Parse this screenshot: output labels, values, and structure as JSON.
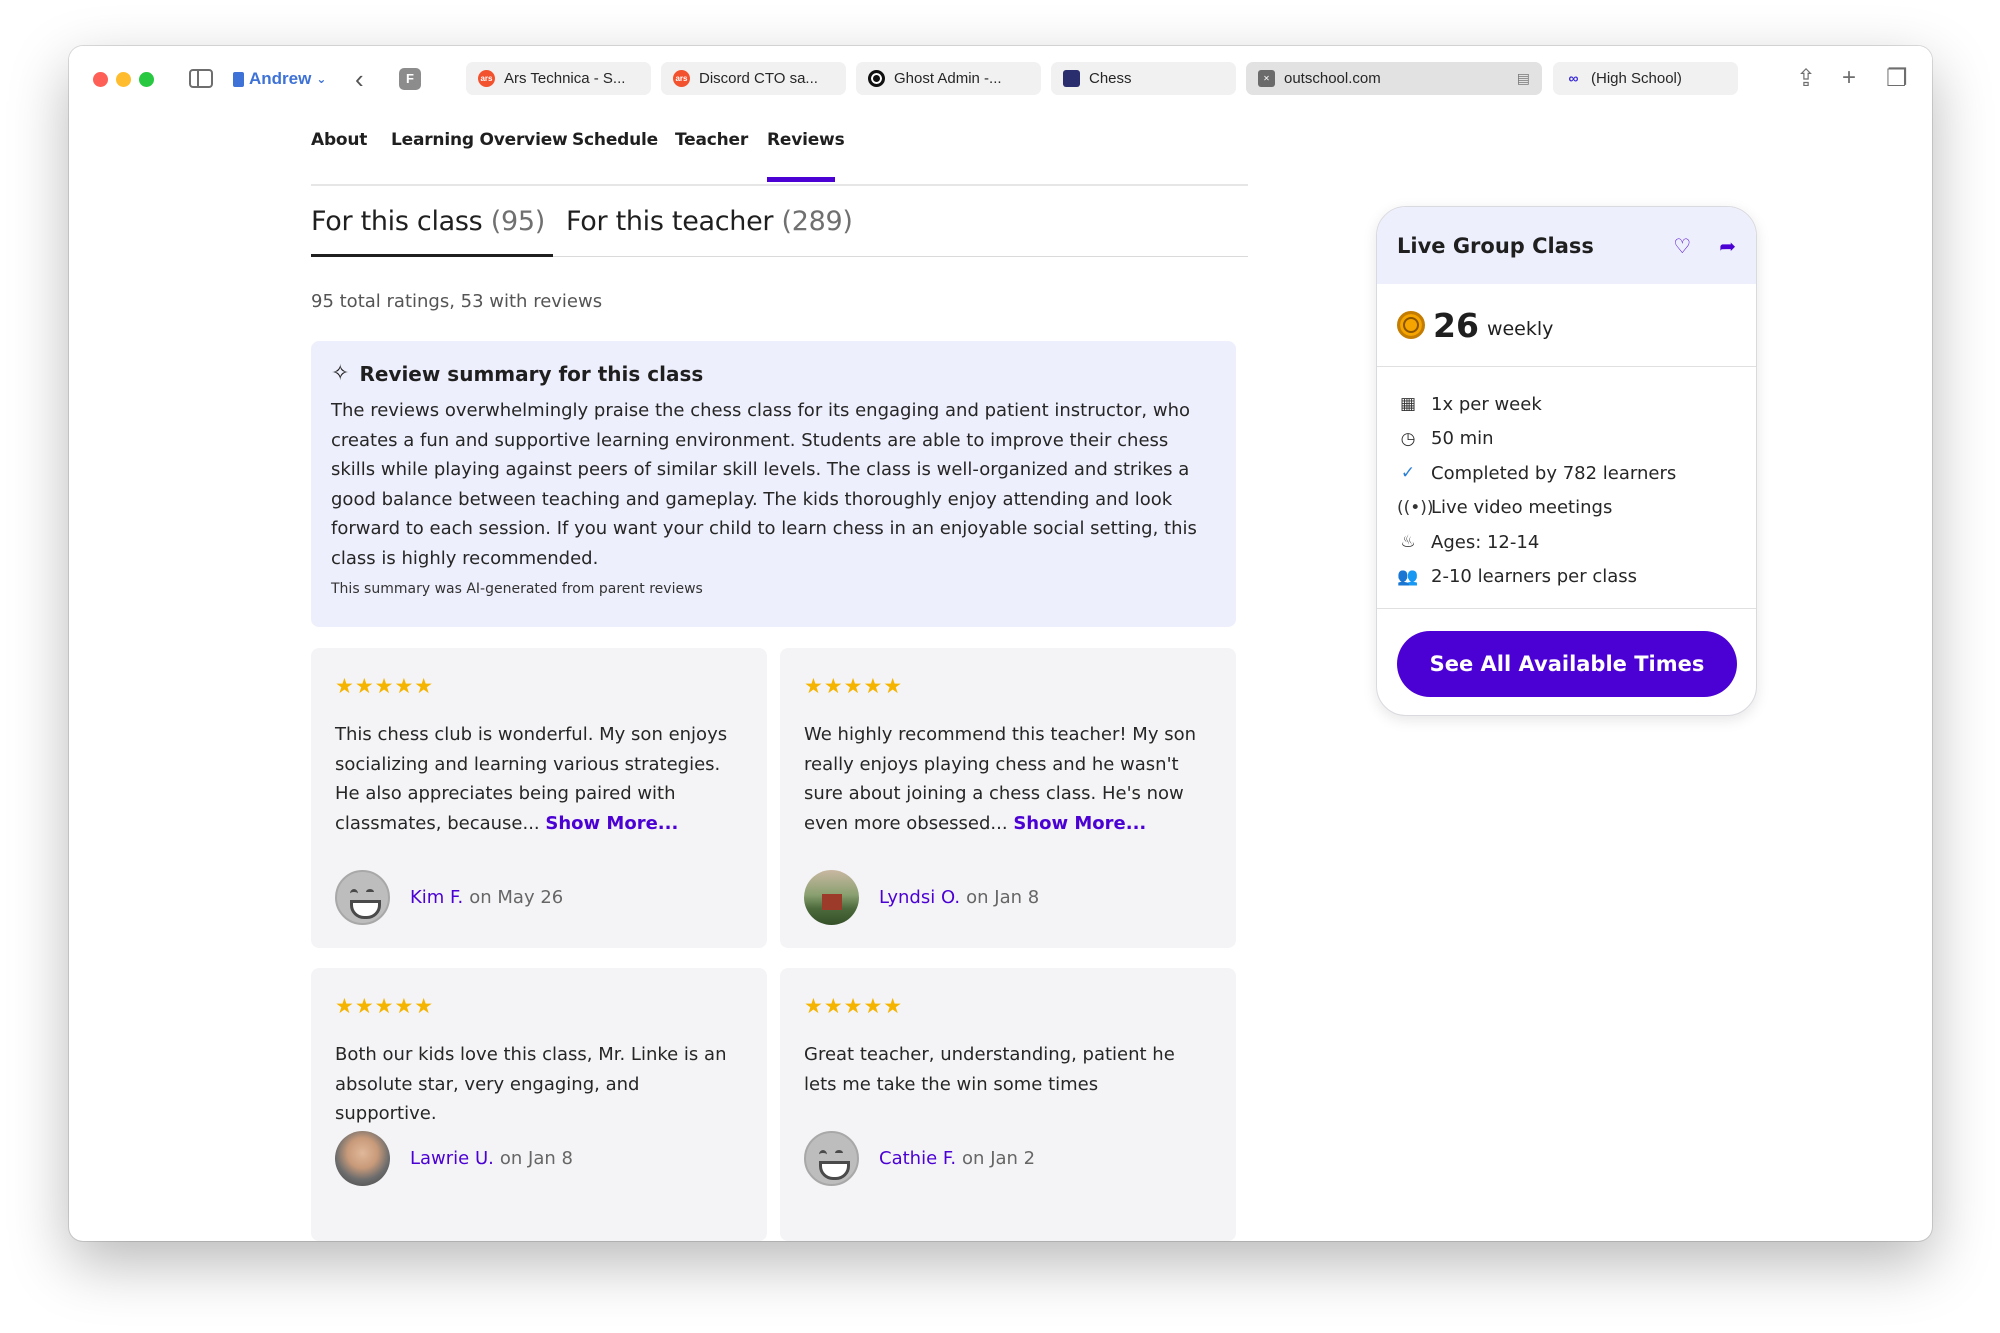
{
  "browser": {
    "profile": "Andrew",
    "tabs": [
      {
        "title": "Ars Technica - S...",
        "favicon": "ars-icon"
      },
      {
        "title": "Discord CTO sa...",
        "favicon": "ars-icon"
      },
      {
        "title": "Ghost Admin -...",
        "favicon": "ghost-icon"
      },
      {
        "title": "Chess",
        "favicon": "chess-icon"
      },
      {
        "title": "outschool.com",
        "favicon": "close-icon",
        "active": true
      },
      {
        "title": "(High School)",
        "favicon": "link-icon"
      }
    ]
  },
  "nav": {
    "items": [
      "About",
      "Learning Overview",
      "Schedule",
      "Teacher",
      "Reviews"
    ],
    "active": "Reviews"
  },
  "review_tabs": {
    "class": {
      "label": "For this class",
      "count": "(95)"
    },
    "teacher": {
      "label": "For this teacher",
      "count": "(289)"
    }
  },
  "ratings_line": "95 total ratings, 53 with reviews",
  "summary": {
    "title": "Review summary for this class",
    "body": "The reviews overwhelmingly praise the chess class for its engaging and patient instructor, who creates a fun and supportive learning environment. Students are able to improve their chess skills while playing against peers of similar skill levels. The class is well-organized and strikes a good balance between teaching and gameplay. The kids thoroughly enjoy attending and look forward to each session. If you want your child to learn chess in an enjoyable social setting, this class is highly recommended.",
    "note": "This summary was AI-generated from parent reviews"
  },
  "reviews": [
    {
      "stars": "★★★★★",
      "rating": 5,
      "text": "This chess club is wonderful. My son enjoys socializing and learning various strategies. He also appreciates being paired with classmates, because...",
      "more": "Show More...",
      "name": "Kim F.",
      "date": "on May 26"
    },
    {
      "stars": "★★★★★",
      "rating": 5,
      "text": "We highly recommend this teacher! My son really enjoys playing chess and he wasn't sure about joining a chess class. He's now even more obsessed...",
      "more": "Show More...",
      "name": "Lyndsi O.",
      "date": "on Jan 8"
    },
    {
      "stars": "★★★★★",
      "rating": 5,
      "text": "Both our kids love this class, Mr. Linke is an absolute star, very engaging, and supportive.",
      "more": "",
      "name": "Lawrie U.",
      "date": "on Jan 8"
    },
    {
      "stars": "★★★★★",
      "rating": 5,
      "text": "Great teacher, understanding, patient he lets me take the win some times",
      "more": "",
      "name": "Cathie F.",
      "date": "on Jan 2"
    }
  ],
  "booking": {
    "title": "Live Group Class",
    "price": "26",
    "price_unit": "weekly",
    "details": [
      {
        "icon": "calendar-icon",
        "text": "1x per week"
      },
      {
        "icon": "clock-icon",
        "text": "50 min"
      },
      {
        "icon": "check-icon",
        "text": "Completed by 782 learners"
      },
      {
        "icon": "broadcast-icon",
        "text": "Live video meetings"
      },
      {
        "icon": "cake-icon",
        "text": "Ages: 12-14"
      },
      {
        "icon": "people-icon",
        "text": "2-10 learners per class"
      }
    ],
    "cta": "See All Available Times"
  },
  "colors": {
    "accent": "#4b01d4",
    "star": "#f5b400",
    "summary_bg": "#eeeffc",
    "card_bg": "#f4f4f6"
  }
}
